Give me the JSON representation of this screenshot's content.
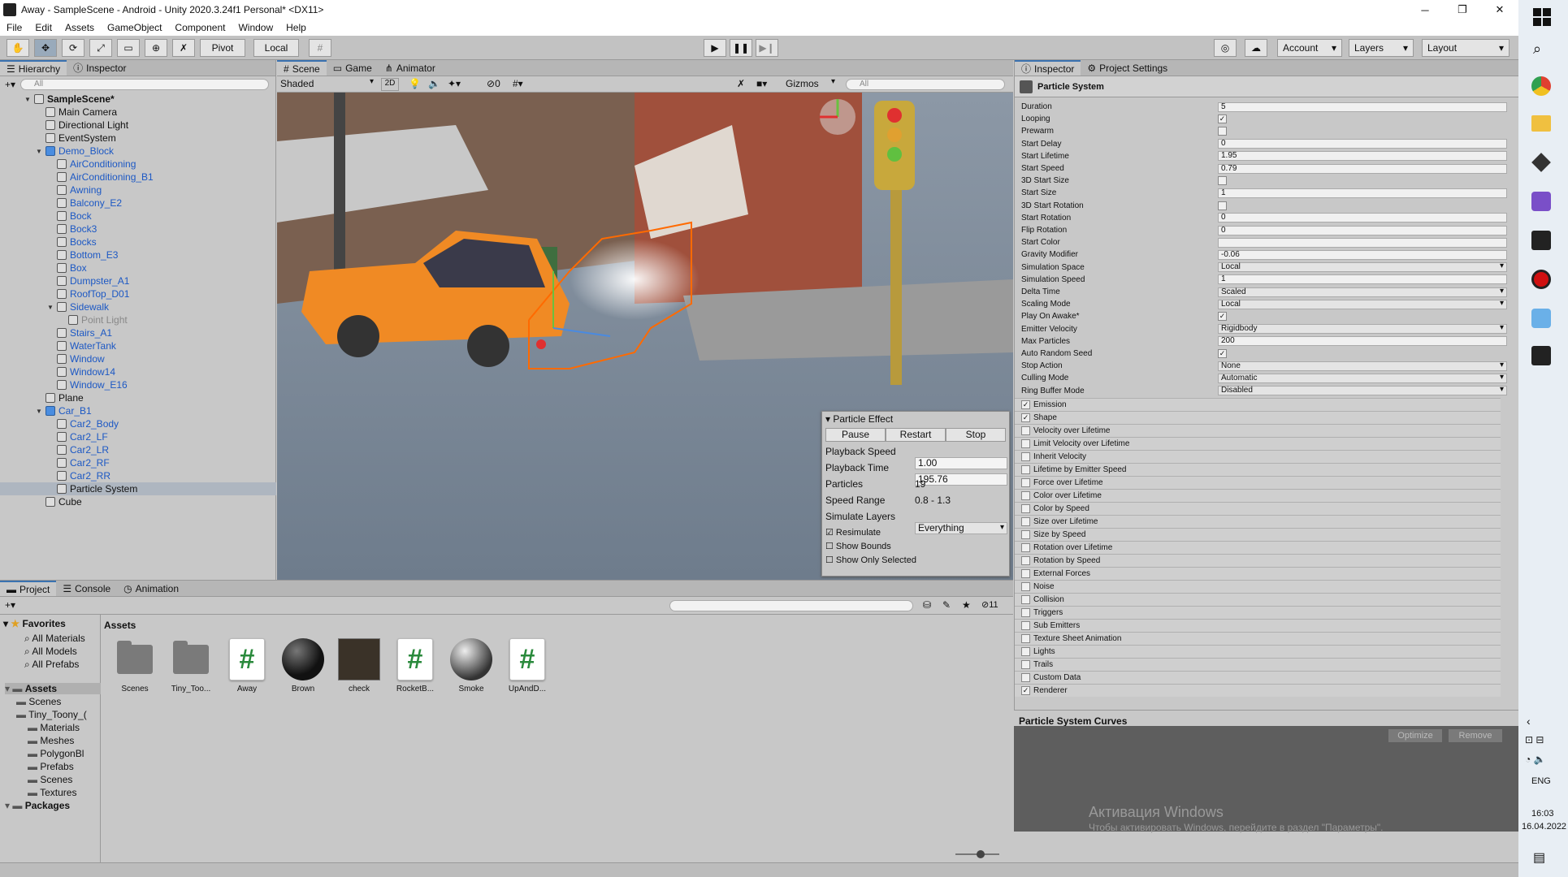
{
  "window": {
    "title": "Away - SampleScene - Android - Unity 2020.3.24f1 Personal* <DX11>",
    "min": "─",
    "max": "❐",
    "close": "✕"
  },
  "menu": [
    "File",
    "Edit",
    "Assets",
    "GameObject",
    "Component",
    "Window",
    "Help"
  ],
  "toolbar": {
    "pivot": "Pivot",
    "local": "Local",
    "account": "Account",
    "layers": "Layers",
    "layout": "Layout"
  },
  "hierarchy": {
    "tab": "Hierarchy",
    "tab2": "Inspector",
    "search_placeholder": "All",
    "items": [
      {
        "label": "SampleScene*",
        "depth": 0,
        "type": "scene",
        "bold": true
      },
      {
        "label": "Main Camera",
        "depth": 1
      },
      {
        "label": "Directional Light",
        "depth": 1
      },
      {
        "label": "EventSystem",
        "depth": 1
      },
      {
        "label": "Demo_Block",
        "depth": 1,
        "type": "prefab",
        "expanded": true
      },
      {
        "label": "AirConditioning",
        "depth": 2,
        "color": "blue"
      },
      {
        "label": "AirConditioning_B1",
        "depth": 2,
        "color": "blue"
      },
      {
        "label": "Awning",
        "depth": 2,
        "color": "blue"
      },
      {
        "label": "Balcony_E2",
        "depth": 2,
        "color": "blue"
      },
      {
        "label": "Bock",
        "depth": 2,
        "color": "blue"
      },
      {
        "label": "Bock3",
        "depth": 2,
        "color": "blue"
      },
      {
        "label": "Bocks",
        "depth": 2,
        "color": "blue"
      },
      {
        "label": "Bottom_E3",
        "depth": 2,
        "color": "blue"
      },
      {
        "label": "Box",
        "depth": 2,
        "color": "blue"
      },
      {
        "label": "Dumpster_A1",
        "depth": 2,
        "color": "blue"
      },
      {
        "label": "RoofTop_D01",
        "depth": 2,
        "color": "blue"
      },
      {
        "label": "Sidewalk",
        "depth": 2,
        "color": "blue",
        "expanded": true
      },
      {
        "label": "Point Light",
        "depth": 3,
        "color": "grey"
      },
      {
        "label": "Stairs_A1",
        "depth": 2,
        "color": "blue"
      },
      {
        "label": "WaterTank",
        "depth": 2,
        "color": "blue"
      },
      {
        "label": "Window",
        "depth": 2,
        "color": "blue"
      },
      {
        "label": "Window14",
        "depth": 2,
        "color": "blue"
      },
      {
        "label": "Window_E16",
        "depth": 2,
        "color": "blue"
      },
      {
        "label": "Plane",
        "depth": 1
      },
      {
        "label": "Car_B1",
        "depth": 1,
        "type": "prefab",
        "expanded": true
      },
      {
        "label": "Car2_Body",
        "depth": 2,
        "color": "blue"
      },
      {
        "label": "Car2_LF",
        "depth": 2,
        "color": "blue"
      },
      {
        "label": "Car2_LR",
        "depth": 2,
        "color": "blue"
      },
      {
        "label": "Car2_RF",
        "depth": 2,
        "color": "blue"
      },
      {
        "label": "Car2_RR",
        "depth": 2,
        "color": "blue"
      },
      {
        "label": "Particle System",
        "depth": 2,
        "selected": true
      },
      {
        "label": "Cube",
        "depth": 1
      }
    ]
  },
  "scene": {
    "tabs": [
      "Scene",
      "Game",
      "Animator"
    ],
    "shading": "Shaded",
    "mode2d": "2D",
    "hidden_count": "0",
    "gizmos": "Gizmos",
    "search_placeholder": "All"
  },
  "particle_effect": {
    "title": "Particle Effect",
    "pause": "Pause",
    "restart": "Restart",
    "stop": "Stop",
    "playback_speed_label": "Playback Speed",
    "playback_speed": "1.00",
    "playback_time_label": "Playback Time",
    "playback_time": "195.76",
    "particles_label": "Particles",
    "particles": "19",
    "speed_range_label": "Speed Range",
    "speed_range": "0.8 - 1.3",
    "simulate_layers_label": "Simulate Layers",
    "simulate_layers": "Everything",
    "resimulate": "Resimulate",
    "show_bounds": "Show Bounds",
    "show_only_selected": "Show Only Selected"
  },
  "inspector": {
    "tab": "Inspector",
    "tab2": "Project Settings",
    "component": "Particle System",
    "fields": [
      {
        "label": "Duration",
        "type": "val",
        "value": "5"
      },
      {
        "label": "Looping",
        "type": "chk",
        "value": "✓"
      },
      {
        "label": "Prewarm",
        "type": "chk",
        "value": ""
      },
      {
        "label": "Start Delay",
        "type": "val",
        "value": "0"
      },
      {
        "label": "Start Lifetime",
        "type": "val",
        "value": "1.95"
      },
      {
        "label": "Start Speed",
        "type": "val",
        "value": "0.79"
      },
      {
        "label": "3D Start Size",
        "type": "chk",
        "value": ""
      },
      {
        "label": "Start Size",
        "type": "val",
        "value": "1"
      },
      {
        "label": "3D Start Rotation",
        "type": "chk",
        "value": ""
      },
      {
        "label": "Start Rotation",
        "type": "val",
        "value": "0"
      },
      {
        "label": "Flip Rotation",
        "type": "val",
        "value": "0"
      },
      {
        "label": "Start Color",
        "type": "val",
        "value": ""
      },
      {
        "label": "Gravity Modifier",
        "type": "val",
        "value": "-0.06"
      },
      {
        "label": "Simulation Space",
        "type": "dd",
        "value": "Local"
      },
      {
        "label": "Simulation Speed",
        "type": "val",
        "value": "1"
      },
      {
        "label": "Delta Time",
        "type": "dd",
        "value": "Scaled"
      },
      {
        "label": "Scaling Mode",
        "type": "dd",
        "value": "Local"
      },
      {
        "label": "Play On Awake*",
        "type": "chk",
        "value": "✓"
      },
      {
        "label": "Emitter Velocity",
        "type": "dd",
        "value": "Rigidbody"
      },
      {
        "label": "Max Particles",
        "type": "val",
        "value": "200"
      },
      {
        "label": "Auto Random Seed",
        "type": "chk",
        "value": "✓"
      },
      {
        "label": "Stop Action",
        "type": "dd",
        "value": "None"
      },
      {
        "label": "Culling Mode",
        "type": "dd",
        "value": "Automatic"
      },
      {
        "label": "Ring Buffer Mode",
        "type": "dd",
        "value": "Disabled"
      }
    ],
    "modules": [
      {
        "label": "Emission",
        "checked": "✓"
      },
      {
        "label": "Shape",
        "checked": "✓"
      },
      {
        "label": "Velocity over Lifetime",
        "checked": ""
      },
      {
        "label": "Limit Velocity over Lifetime",
        "checked": ""
      },
      {
        "label": "Inherit Velocity",
        "checked": ""
      },
      {
        "label": "Lifetime by Emitter Speed",
        "checked": ""
      },
      {
        "label": "Force over Lifetime",
        "checked": ""
      },
      {
        "label": "Color over Lifetime",
        "checked": ""
      },
      {
        "label": "Color by Speed",
        "checked": ""
      },
      {
        "label": "Size over Lifetime",
        "checked": ""
      },
      {
        "label": "Size by Speed",
        "checked": ""
      },
      {
        "label": "Rotation over Lifetime",
        "checked": ""
      },
      {
        "label": "Rotation by Speed",
        "checked": ""
      },
      {
        "label": "External Forces",
        "checked": ""
      },
      {
        "label": "Noise",
        "checked": ""
      },
      {
        "label": "Collision",
        "checked": ""
      },
      {
        "label": "Triggers",
        "checked": ""
      },
      {
        "label": "Sub Emitters",
        "checked": ""
      },
      {
        "label": "Texture Sheet Animation",
        "checked": ""
      },
      {
        "label": "Lights",
        "checked": ""
      },
      {
        "label": "Trails",
        "checked": ""
      },
      {
        "label": "Custom Data",
        "checked": ""
      },
      {
        "label": "Renderer",
        "checked": "✓"
      }
    ],
    "curves_title": "Particle System Curves",
    "optimize": "Optimize",
    "remove": "Remove",
    "watermark1": "Активация Windows",
    "watermark2": "Чтобы активировать Windows, перейдите в раздел \"Параметры\"."
  },
  "project": {
    "tabs": [
      "Project",
      "Console",
      "Animation"
    ],
    "hidden_count": "11",
    "favorites_label": "Favorites",
    "favorites": [
      "All Materials",
      "All Models",
      "All Prefabs"
    ],
    "tree": [
      {
        "label": "Assets",
        "depth": 0,
        "bold": true
      },
      {
        "label": "Scenes",
        "depth": 1
      },
      {
        "label": "Tiny_Toony_(",
        "depth": 1
      },
      {
        "label": "Materials",
        "depth": 2
      },
      {
        "label": "Meshes",
        "depth": 2
      },
      {
        "label": "PolygonBl",
        "depth": 2
      },
      {
        "label": "Prefabs",
        "depth": 2
      },
      {
        "label": "Scenes",
        "depth": 2
      },
      {
        "label": "Textures",
        "depth": 2
      },
      {
        "label": "Packages",
        "depth": 0,
        "bold": true
      }
    ],
    "breadcrumb": "Assets",
    "assets": [
      {
        "label": "Scenes",
        "kind": "folder"
      },
      {
        "label": "Tiny_Too...",
        "kind": "folder"
      },
      {
        "label": "Away",
        "kind": "script"
      },
      {
        "label": "Brown",
        "kind": "sphere-dark"
      },
      {
        "label": "check",
        "kind": "texture"
      },
      {
        "label": "RocketB...",
        "kind": "script"
      },
      {
        "label": "Smoke",
        "kind": "sphere-grey"
      },
      {
        "label": "UpAndD...",
        "kind": "script"
      }
    ]
  },
  "taskbar": {
    "lang": "ENG",
    "time": "16:03",
    "date": "16.04.2022"
  }
}
